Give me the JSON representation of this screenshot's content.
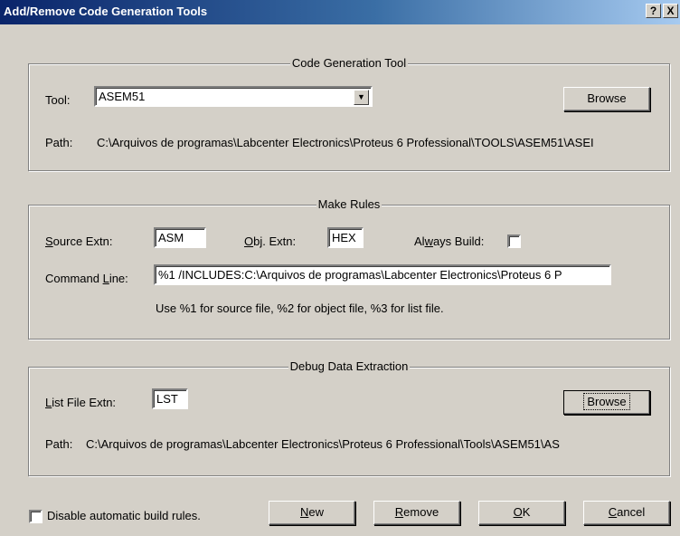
{
  "window": {
    "title": "Add/Remove Code Generation Tools",
    "help_label": "?",
    "close_label": "X"
  },
  "code_generation_tool": {
    "legend": "Code Generation Tool",
    "tool_label": "Tool:",
    "tool_value": "ASEM51",
    "browse_label": "Browse",
    "path_label": "Path:",
    "path_value": "C:\\Arquivos de programas\\Labcenter Electronics\\Proteus 6 Professional\\TOOLS\\ASEM51\\ASEI"
  },
  "make_rules": {
    "legend": "Make Rules",
    "source_extn_label": "Source Extn:",
    "source_extn_value": "ASM",
    "obj_extn_label": "Obj. Extn:",
    "obj_extn_value": "HEX",
    "always_build_label": "Always Build:",
    "always_build_checked": false,
    "command_line_label": "Command Line:",
    "command_line_value": "%1 /INCLUDES:C:\\Arquivos de programas\\Labcenter Electronics\\Proteus 6 P",
    "hint": "Use %1 for source file, %2 for object file, %3 for list file."
  },
  "debug_data_extraction": {
    "legend": "Debug Data Extraction",
    "list_file_extn_label": "List File Extn:",
    "list_file_extn_value": "LST",
    "browse_label": "Browse",
    "path_label": "Path:",
    "path_value": "C:\\Arquivos de programas\\Labcenter Electronics\\Proteus 6 Professional\\Tools\\ASEM51\\AS"
  },
  "footer": {
    "disable_rules_label": "Disable automatic build rules.",
    "disable_rules_checked": false,
    "new_label": "New",
    "remove_label": "Remove",
    "ok_label": "OK",
    "cancel_label": "Cancel"
  },
  "colors": {
    "title_start": "#0a246a",
    "title_end": "#a6caf0",
    "dialog_bg": "#d4d0c8"
  }
}
